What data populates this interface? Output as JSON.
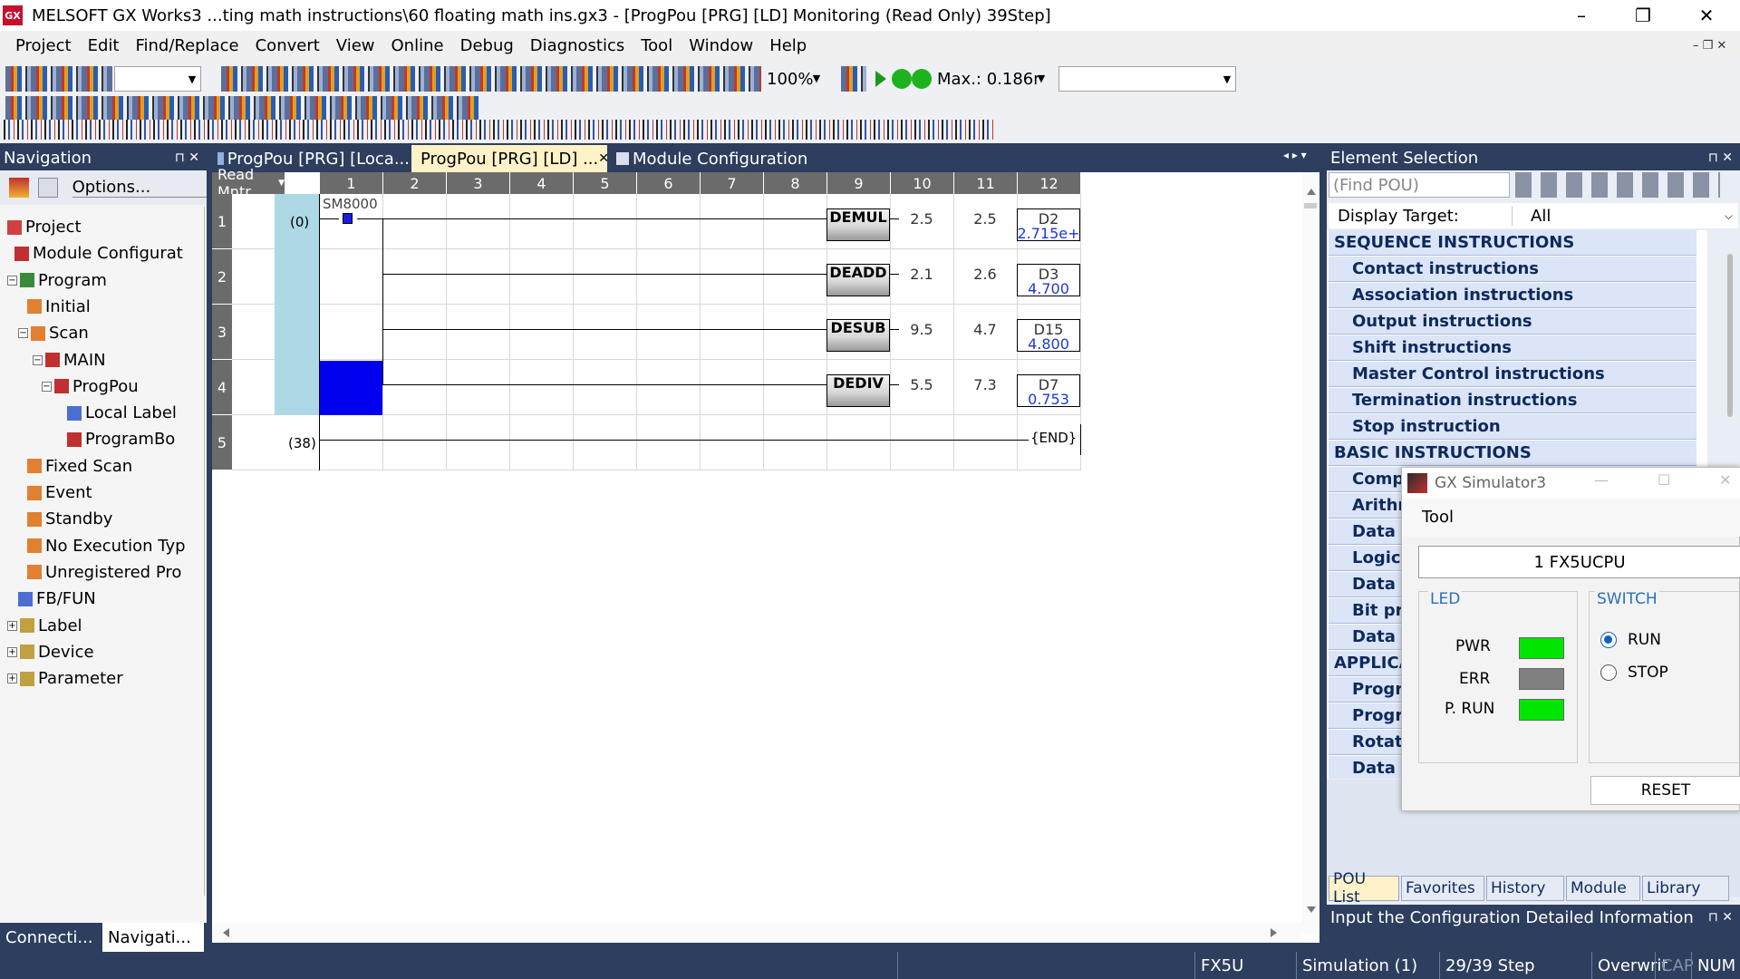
{
  "window": {
    "title": "MELSOFT GX Works3 ...ting math instructions\\60 floating math ins.gx3 - [ProgPou [PRG] [LD] Monitoring (Read Only) 39Step]",
    "minimize": "–",
    "maximize": "❐",
    "close": "✕"
  },
  "menu": [
    "Project",
    "Edit",
    "Find/Replace",
    "Convert",
    "View",
    "Online",
    "Debug",
    "Diagnostics",
    "Tool",
    "Window",
    "Help"
  ],
  "toolbar": {
    "zoom": "100%",
    "scan_time": "Max.: 0.186r",
    "combo2": ""
  },
  "navigation": {
    "title": "Navigation",
    "options_label": "Options...",
    "tree": [
      {
        "label": "Project",
        "exp": ""
      },
      {
        "label": "Module Configurat",
        "exp": ""
      },
      {
        "label": "Program",
        "exp": "−"
      },
      {
        "label": "Initial",
        "exp": ""
      },
      {
        "label": "Scan",
        "exp": "−"
      },
      {
        "label": "MAIN",
        "exp": "−"
      },
      {
        "label": "ProgPou",
        "exp": "−"
      },
      {
        "label": "Local Label",
        "exp": ""
      },
      {
        "label": "ProgramBo",
        "exp": ""
      },
      {
        "label": "Fixed Scan",
        "exp": ""
      },
      {
        "label": "Event",
        "exp": ""
      },
      {
        "label": "Standby",
        "exp": ""
      },
      {
        "label": "No Execution Typ",
        "exp": ""
      },
      {
        "label": "Unregistered Pro",
        "exp": ""
      },
      {
        "label": "FB/FUN",
        "exp": ""
      },
      {
        "label": "Label",
        "exp": "+"
      },
      {
        "label": "Device",
        "exp": "+"
      },
      {
        "label": "Parameter",
        "exp": "+"
      }
    ],
    "bottom_tabs": [
      "Connecti...",
      "Navigati..."
    ]
  },
  "doc_tabs": [
    "ProgPou [PRG] [Loca...",
    "ProgPou [PRG] [LD] ...",
    "Module Configuration"
  ],
  "ladder": {
    "mode": "Read Mntr",
    "columns": [
      "1",
      "2",
      "3",
      "4",
      "5",
      "6",
      "7",
      "8",
      "9",
      "10",
      "11",
      "12"
    ],
    "rows": [
      "1",
      "2",
      "3",
      "4",
      "5"
    ],
    "step0": "(0)",
    "step38": "(38)",
    "contact": "SM8000",
    "instructions": [
      {
        "name": "DEMUL",
        "s1": "2.5",
        "s2": "2.5",
        "dev": "D2",
        "val": "2.715e+"
      },
      {
        "name": "DEADD",
        "s1": "2.1",
        "s2": "2.6",
        "dev": "D3",
        "val": "4.700"
      },
      {
        "name": "DESUB",
        "s1": "9.5",
        "s2": "4.7",
        "dev": "D15",
        "val": "4.800"
      },
      {
        "name": "DEDIV",
        "s1": "5.5",
        "s2": "7.3",
        "dev": "D7",
        "val": "0.753"
      }
    ],
    "end": "END"
  },
  "element_selection": {
    "title": "Element Selection",
    "find_placeholder": "(Find POU)",
    "display_target_label": "Display Target:",
    "display_target_value": "All",
    "items": [
      {
        "text": "SEQUENCE INSTRUCTIONS",
        "head": true
      },
      {
        "text": "Contact instructions",
        "head": false
      },
      {
        "text": "Association instructions",
        "head": false
      },
      {
        "text": "Output instructions",
        "head": false
      },
      {
        "text": "Shift instructions",
        "head": false
      },
      {
        "text": "Master Control instructions",
        "head": false
      },
      {
        "text": "Termination instructions",
        "head": false
      },
      {
        "text": "Stop instruction",
        "head": false
      },
      {
        "text": "BASIC INSTRUCTIONS",
        "head": true
      },
      {
        "text": "Compa",
        "head": false
      },
      {
        "text": "Arithm",
        "head": false
      },
      {
        "text": "Data tr",
        "head": false
      },
      {
        "text": "Logica",
        "head": false
      },
      {
        "text": "Data sl",
        "head": false
      },
      {
        "text": "Bit pro",
        "head": false
      },
      {
        "text": "Data C",
        "head": false
      },
      {
        "text": "APPLICAT",
        "head": true
      },
      {
        "text": "Progra",
        "head": false
      },
      {
        "text": "Progra",
        "head": false
      },
      {
        "text": "Rotatic",
        "head": false
      },
      {
        "text": "Data p",
        "head": false
      }
    ],
    "bottom_tabs": [
      "POU List",
      "Favorites",
      "History",
      "Module",
      "Library"
    ],
    "config_title": "Input the Configuration Detailed Information"
  },
  "simulator": {
    "title": "GX Simulator3",
    "menu": "Tool",
    "cpu": "1  FX5UCPU",
    "led_label": "LED",
    "switch_label": "SWITCH",
    "pwr": "PWR",
    "err": "ERR",
    "prun": "P. RUN",
    "run": "RUN",
    "stop": "STOP",
    "reset": "RESET",
    "colors": {
      "pwr": "#00e600",
      "err": "#808080",
      "prun": "#00e600"
    }
  },
  "status": {
    "model": "FX5U",
    "sim": "Simulation (1)",
    "steps": "29/39 Step",
    "overwrite": "Overwrit",
    "cap": "CAP",
    "num": "NUM"
  }
}
